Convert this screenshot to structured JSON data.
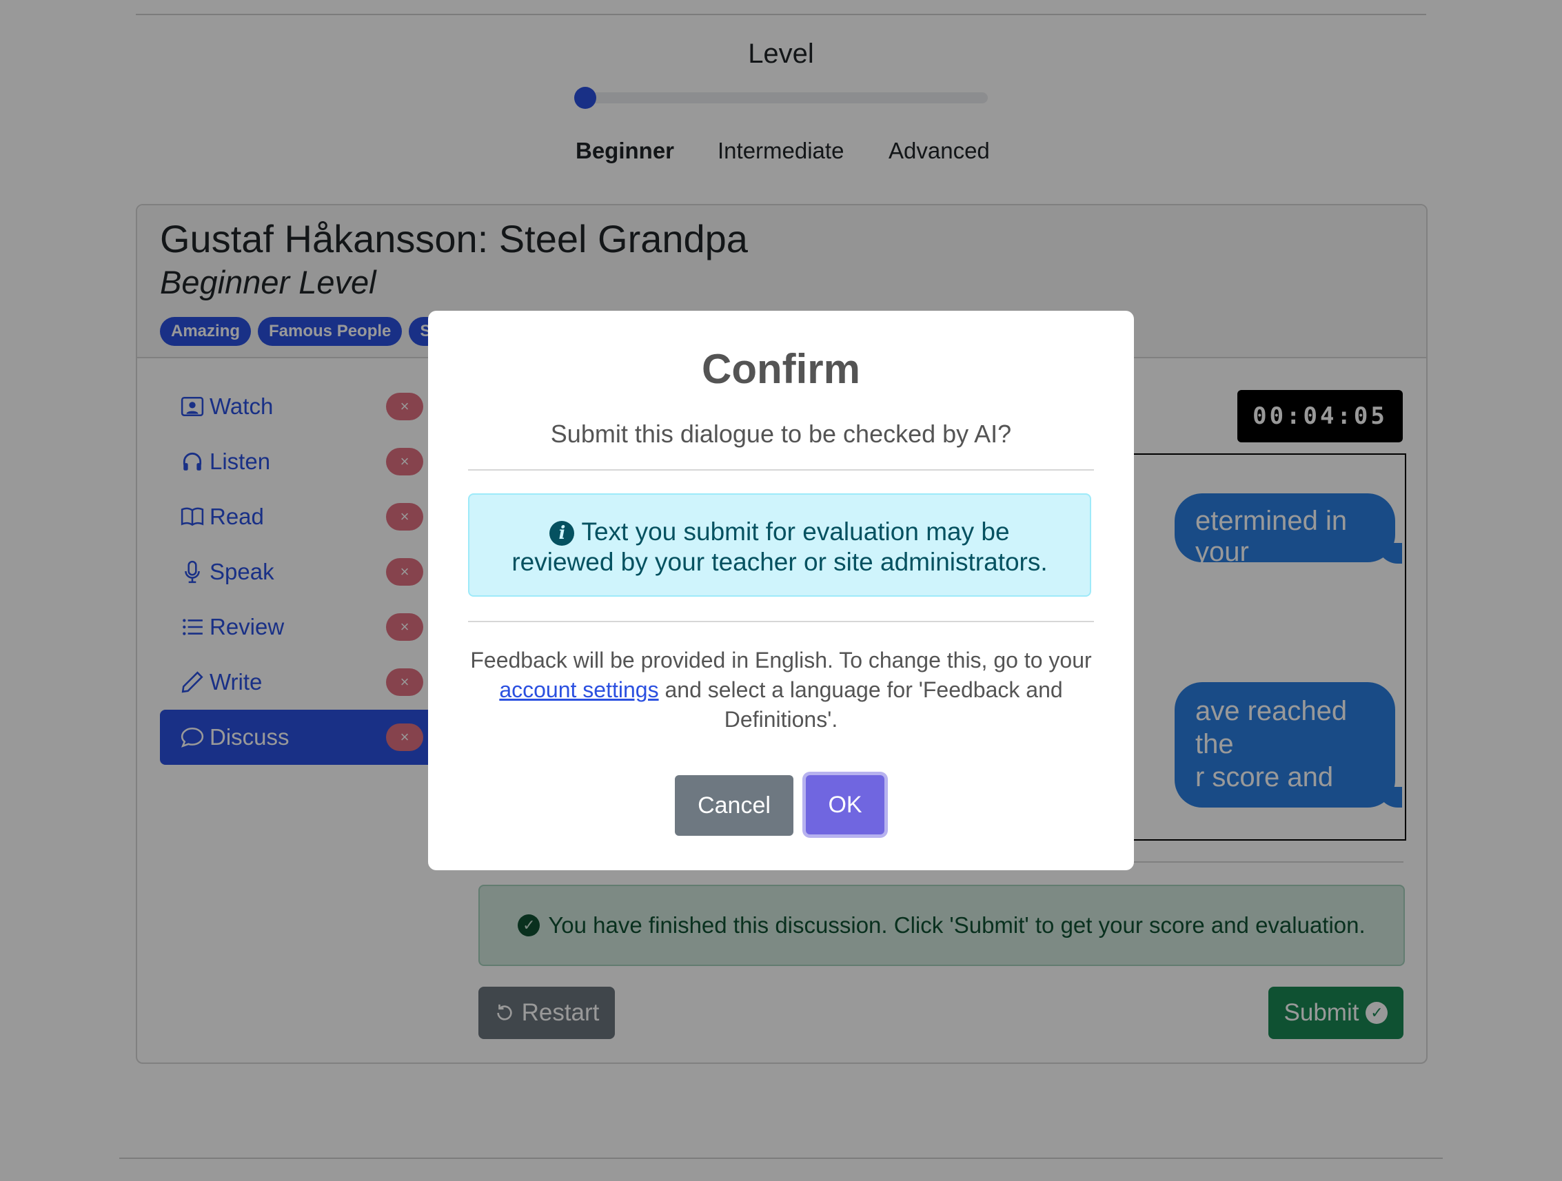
{
  "level": {
    "title": "Level",
    "options": [
      "Beginner",
      "Intermediate",
      "Advanced"
    ],
    "selected": "Beginner",
    "slider_position": 0
  },
  "lesson": {
    "title": "Gustaf Håkansson: Steel Grandpa",
    "subtitle": "Beginner Level",
    "tags": [
      "Amazing",
      "Famous People",
      "S"
    ]
  },
  "nav": {
    "items": [
      {
        "label": "Watch",
        "icon": "person-video-icon"
      },
      {
        "label": "Listen",
        "icon": "headphones-icon"
      },
      {
        "label": "Read",
        "icon": "book-icon"
      },
      {
        "label": "Speak",
        "icon": "microphone-icon"
      },
      {
        "label": "Review",
        "icon": "list-icon"
      },
      {
        "label": "Write",
        "icon": "pencil-icon"
      },
      {
        "label": "Discuss",
        "icon": "chat-icon"
      }
    ],
    "active": "Discuss",
    "badge_symbol": "×"
  },
  "discussion": {
    "timer": "00:04:05",
    "bubble1_text": "etermined in your",
    "bubble2_line1": "ave reached the",
    "bubble2_line2": "r score and",
    "success_message": "You have finished this discussion. Click 'Submit' to get your score and evaluation.",
    "restart_label": "Restart",
    "submit_label": "Submit"
  },
  "modal": {
    "title": "Confirm",
    "question": "Submit this dialogue to be checked by AI?",
    "info_text": "Text you submit for evaluation may be reviewed by your teacher or site administrators.",
    "feedback_before": "Feedback will be provided in English. To change this, go to your ",
    "feedback_link": "account settings",
    "feedback_after": " and select a language for 'Feedback and Definitions'.",
    "cancel_label": "Cancel",
    "ok_label": "OK"
  },
  "colors": {
    "primary": "#2b50e0",
    "ok_button": "#7066e0",
    "cancel_button": "#6e7881",
    "success_bg": "#d1e7dd",
    "info_bg": "#cff4fc"
  }
}
